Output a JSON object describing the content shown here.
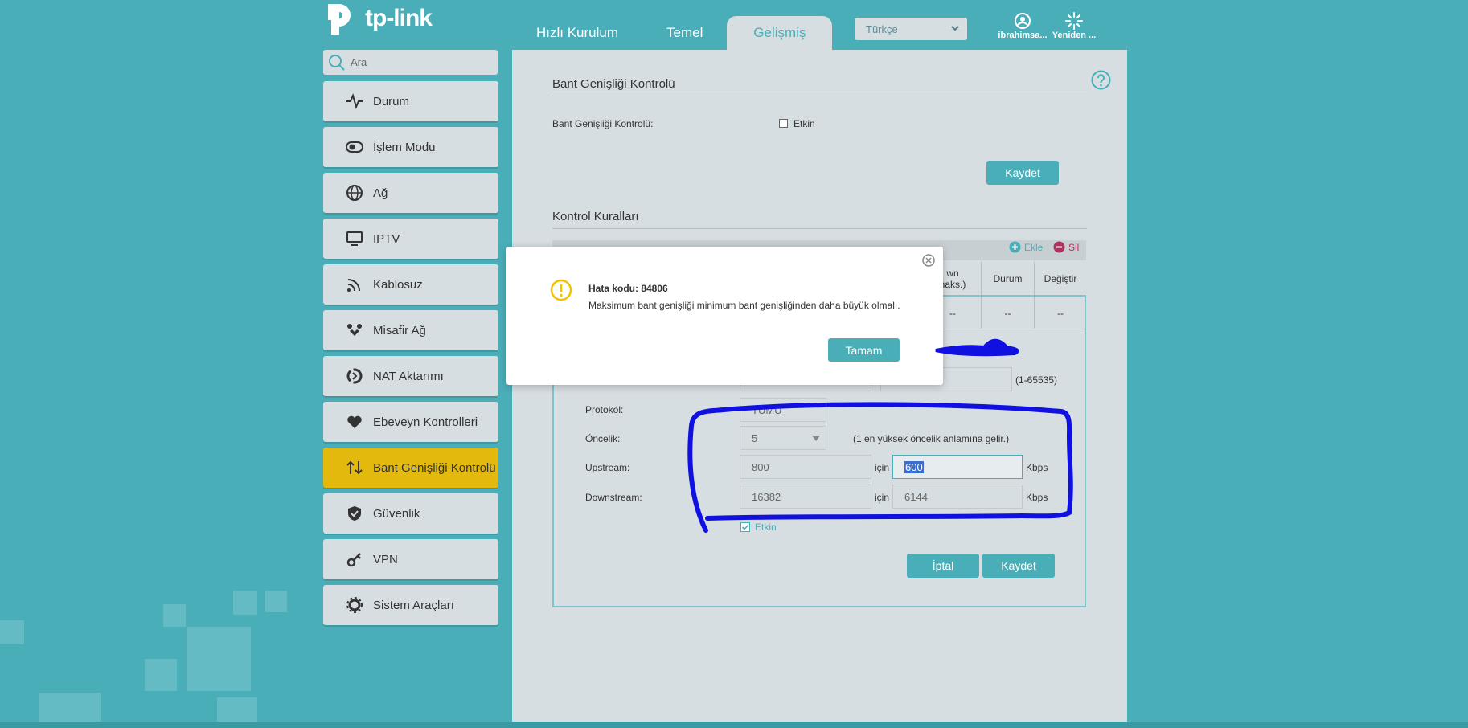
{
  "brand": {
    "name": "tp-link"
  },
  "header": {
    "tabs": [
      {
        "label": "Hızlı Kurulum"
      },
      {
        "label": "Temel"
      },
      {
        "label": "Gelişmiş",
        "active": true
      }
    ],
    "language": "Türkçe",
    "user_label": "ibrahimsa...",
    "reboot_label": "Yeniden ..."
  },
  "sidebar": {
    "search_placeholder": "Ara",
    "items": [
      {
        "label": "Durum",
        "icon": "pulse-icon"
      },
      {
        "label": "İşlem Modu",
        "icon": "toggle-icon"
      },
      {
        "label": "Ağ",
        "icon": "globe-icon"
      },
      {
        "label": "IPTV",
        "icon": "monitor-icon"
      },
      {
        "label": "Kablosuz",
        "icon": "wifi-icon"
      },
      {
        "label": "Misafir Ağ",
        "icon": "guests-icon"
      },
      {
        "label": "NAT Aktarımı",
        "icon": "nat-icon"
      },
      {
        "label": "Ebeveyn Kontrolleri",
        "icon": "heart-icon"
      },
      {
        "label": "Bant Genişliği Kontrolü",
        "icon": "updown-arrows-icon",
        "active": true
      },
      {
        "label": "Güvenlik",
        "icon": "shield-icon"
      },
      {
        "label": "VPN",
        "icon": "key-icon"
      },
      {
        "label": "Sistem Araçları",
        "icon": "gear-icon"
      }
    ]
  },
  "bandwidth": {
    "section_title": "Bant Genişliği Kontrolü",
    "control_label": "Bant Genişliği Kontrolü:",
    "enable_label": "Etkin",
    "save_label": "Kaydet"
  },
  "rules": {
    "section_title": "Kontrol Kuralları",
    "add_label": "Ekle",
    "delete_label": "Sil",
    "columns": [
      "wn\nnaks.)",
      "Durum",
      "Değiştir"
    ],
    "row": [
      "--",
      "--",
      "--"
    ],
    "form": {
      "port_hint": "(1-65535)",
      "protocol_label": "Protokol:",
      "protocol_value": "TÜMÜ",
      "priority_label": "Öncelik:",
      "priority_value": "5",
      "priority_hint": "(1 en yüksek öncelik anlamına gelir.)",
      "upstream_label": "Upstream:",
      "upstream_min": "800",
      "upstream_max": "600",
      "downstream_label": "Downstream:",
      "downstream_min": "16382",
      "downstream_max": "6144",
      "for_label": "için",
      "unit": "Kbps",
      "enabled_label": "Etkin",
      "cancel_label": "İptal",
      "save_label": "Kaydet"
    }
  },
  "dialog": {
    "title": "Hata kodu: 84806",
    "message": "Maksimum bant genişliği minimum bant genişliğinden daha büyük olmalı.",
    "ok_label": "Tamam"
  },
  "colors": {
    "accent": "#4aaeb8",
    "active_nav": "#e2b90c",
    "annotation": "#1010e0"
  }
}
